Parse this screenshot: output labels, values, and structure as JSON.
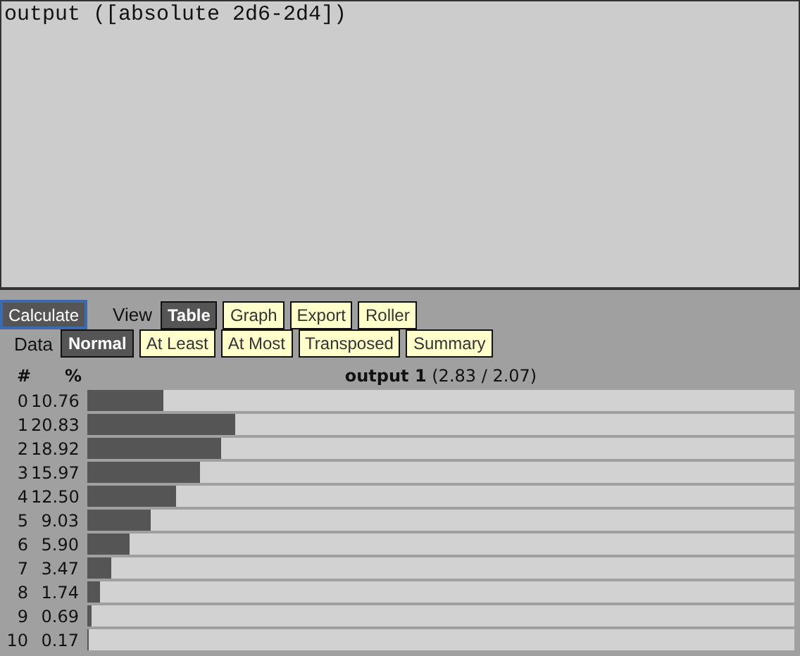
{
  "editor": {
    "value": "output ([absolute 2d6-2d4])"
  },
  "calculate_button": "Calculate",
  "view": {
    "label": "View",
    "options": [
      {
        "label": "Table",
        "selected": true
      },
      {
        "label": "Graph",
        "selected": false
      },
      {
        "label": "Export",
        "selected": false
      },
      {
        "label": "Roller",
        "selected": false
      }
    ]
  },
  "data": {
    "label": "Data",
    "options": [
      {
        "label": "Normal",
        "selected": true
      },
      {
        "label": "At Least",
        "selected": false
      },
      {
        "label": "At Most",
        "selected": false
      },
      {
        "label": "Transposed",
        "selected": false
      },
      {
        "label": "Summary",
        "selected": false
      }
    ]
  },
  "table": {
    "columns": [
      "#",
      "%"
    ],
    "title": "**output 1** (2.83 / 2.07)",
    "rows": [
      {
        "value": "0",
        "percent": "10.76",
        "level": 0.1076
      },
      {
        "value": "1",
        "percent": "20.83",
        "level": 0.2083
      },
      {
        "value": "2",
        "percent": "18.92",
        "level": 0.1892
      },
      {
        "value": "3",
        "percent": "15.97",
        "level": 0.1597
      },
      {
        "value": "4",
        "percent": "12.50",
        "level": 0.125
      },
      {
        "value": "5",
        "percent": "9.03",
        "level": 0.0903
      },
      {
        "value": "6",
        "percent": "5.90",
        "level": 0.059
      },
      {
        "value": "7",
        "percent": "3.47",
        "level": 0.0347
      },
      {
        "value": "8",
        "percent": "1.74",
        "level": 0.0174
      },
      {
        "value": "9",
        "percent": "0.69",
        "level": 0.0069
      },
      {
        "value": "10",
        "percent": "0.17",
        "level": 0.0017
      }
    ]
  }
}
